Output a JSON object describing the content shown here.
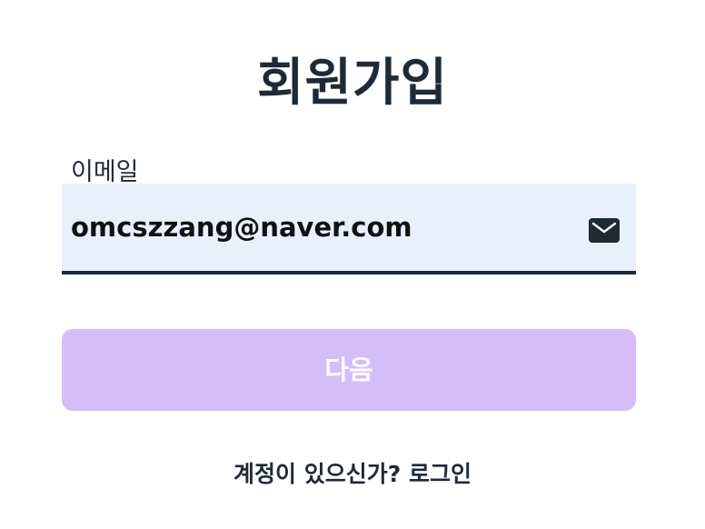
{
  "page": {
    "title": "회원가입"
  },
  "email_field": {
    "label": "이메일",
    "value": "omcszzang@naver.com",
    "icon": "mail-icon"
  },
  "next_button": {
    "label": "다음",
    "color": "#d4bdf8"
  },
  "footer": {
    "prompt": "계정이 있으신가?",
    "login_link": "로그인"
  },
  "colors": {
    "text": "#1f2a37",
    "field_background": "#e9f0fb",
    "button_background": "#d4bdf8"
  }
}
